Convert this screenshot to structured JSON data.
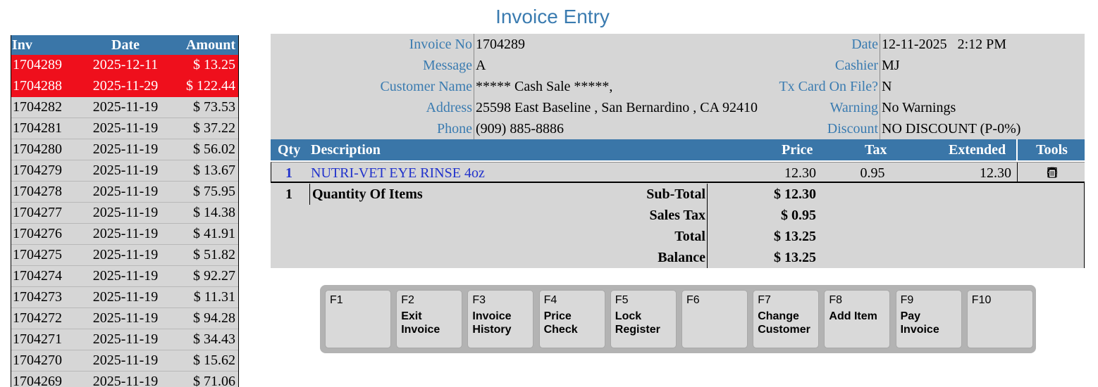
{
  "page_title": "Invoice Entry",
  "invoice_list": {
    "headers": {
      "inv": "Inv",
      "date": "Date",
      "amount": "Amount"
    },
    "rows": [
      {
        "inv": "1704289",
        "date": "2025-12-11",
        "amount": "$ 13.25",
        "highlight": true
      },
      {
        "inv": "1704288",
        "date": "2025-11-29",
        "amount": "$ 122.44",
        "highlight": true
      },
      {
        "inv": "1704282",
        "date": "2025-11-19",
        "amount": "$ 73.53"
      },
      {
        "inv": "1704281",
        "date": "2025-11-19",
        "amount": "$ 37.22"
      },
      {
        "inv": "1704280",
        "date": "2025-11-19",
        "amount": "$ 56.02"
      },
      {
        "inv": "1704279",
        "date": "2025-11-19",
        "amount": "$ 13.67"
      },
      {
        "inv": "1704278",
        "date": "2025-11-19",
        "amount": "$ 75.95"
      },
      {
        "inv": "1704277",
        "date": "2025-11-19",
        "amount": "$ 14.38"
      },
      {
        "inv": "1704276",
        "date": "2025-11-19",
        "amount": "$ 41.91"
      },
      {
        "inv": "1704275",
        "date": "2025-11-19",
        "amount": "$ 51.82"
      },
      {
        "inv": "1704274",
        "date": "2025-11-19",
        "amount": "$ 92.27"
      },
      {
        "inv": "1704273",
        "date": "2025-11-19",
        "amount": "$ 11.31"
      },
      {
        "inv": "1704272",
        "date": "2025-11-19",
        "amount": "$ 94.28"
      },
      {
        "inv": "1704271",
        "date": "2025-11-19",
        "amount": "$ 34.43"
      },
      {
        "inv": "1704270",
        "date": "2025-11-19",
        "amount": "$ 15.62"
      },
      {
        "inv": "1704269",
        "date": "2025-11-19",
        "amount": "$ 71.06"
      }
    ]
  },
  "info": {
    "invoice_no_label": "Invoice No",
    "invoice_no": "1704289",
    "message_label": "Message",
    "message": "A",
    "customer_name_label": "Customer Name",
    "customer_name": "***** Cash Sale *****,",
    "address_label": "Address",
    "address": "25598 East Baseline , San Bernardino , CA 92410",
    "phone_label": "Phone",
    "phone": "(909) 885-8886",
    "date_label": "Date",
    "date": "12-11-2025   2:12 PM",
    "cashier_label": "Cashier",
    "cashier": "MJ",
    "tx_card_label": "Tx Card On File?",
    "tx_card": "N",
    "warning_label": "Warning",
    "warning": "No Warnings",
    "discount_label": "Discount",
    "discount": "NO DISCOUNT (P-0%)"
  },
  "items": {
    "headers": {
      "qty": "Qty",
      "description": "Description",
      "price": "Price",
      "tax": "Tax",
      "extended": "Extended",
      "tools": "Tools"
    },
    "rows": [
      {
        "qty": "1",
        "description": "NUTRI-VET EYE RINSE 4oz",
        "price": "12.30",
        "tax": "0.95",
        "extended": "12.30"
      }
    ],
    "tool_icons": [
      "notes-icon",
      "discount-icon",
      "refresh-icon",
      "trash-icon"
    ]
  },
  "totals": {
    "qty": "1",
    "qty_label": "Quantity Of Items",
    "subtotal_label": "Sub-Total",
    "subtotal": "$ 12.30",
    "tax_label": "Sales Tax",
    "tax": "$ 0.95",
    "total_label": "Total",
    "total": "$ 13.25",
    "balance_label": "Balance",
    "balance": "$ 13.25"
  },
  "function_keys": [
    {
      "key": "F1",
      "label": ""
    },
    {
      "key": "F2",
      "label": "Exit\nInvoice"
    },
    {
      "key": "F3",
      "label": "Invoice\nHistory"
    },
    {
      "key": "F4",
      "label": "Price\nCheck"
    },
    {
      "key": "F5",
      "label": "Lock\nRegister"
    },
    {
      "key": "F6",
      "label": ""
    },
    {
      "key": "F7",
      "label": "Change\nCustomer"
    },
    {
      "key": "F8",
      "label": "Add Item"
    },
    {
      "key": "F9",
      "label": "Pay\nInvoice"
    },
    {
      "key": "F10",
      "label": ""
    }
  ],
  "colors": {
    "accent": "#3a76a8",
    "highlight": "#ef0f1c",
    "panel": "#d6d6d6",
    "link": "#2233cc"
  }
}
